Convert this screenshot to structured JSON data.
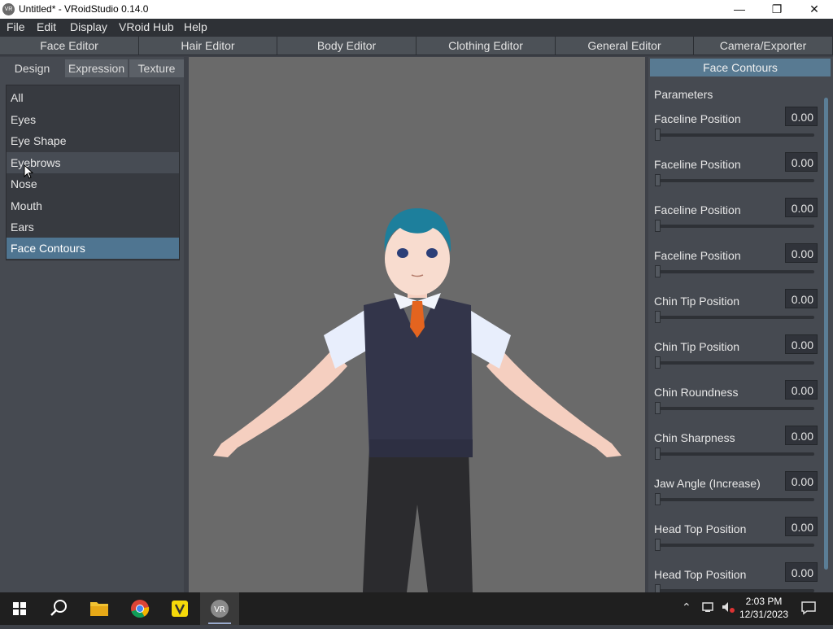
{
  "window": {
    "title": "Untitled* - VRoidStudio 0.14.0",
    "app_icon": "VR",
    "controls": {
      "minimize": "—",
      "maximize": "❐",
      "close": "✕"
    }
  },
  "menu": {
    "items": [
      "File",
      "Edit",
      "Display",
      "VRoid Hub",
      "Help"
    ]
  },
  "editor_tabs": [
    "Face Editor",
    "Hair Editor",
    "Body Editor",
    "Clothing Editor",
    "General Editor",
    "Camera/Exporter"
  ],
  "left_panel": {
    "subtabs": [
      "Design",
      "Expression",
      "Texture"
    ],
    "active_subtab": "Design",
    "categories": [
      "All",
      "Eyes",
      "Eye Shape",
      "Eyebrows",
      "Nose",
      "Mouth",
      "Ears",
      "Face Contours"
    ],
    "selected_category": "Face Contours",
    "hovered_category": "Eyebrows"
  },
  "right_panel": {
    "header": "Face Contours",
    "section_title": "Parameters",
    "params": [
      {
        "label": "Faceline Position",
        "value": "0.00"
      },
      {
        "label": "Faceline Position",
        "value": "0.00"
      },
      {
        "label": "Faceline Position",
        "value": "0.00"
      },
      {
        "label": "Faceline Position",
        "value": "0.00"
      },
      {
        "label": "Chin Tip Position",
        "value": "0.00"
      },
      {
        "label": "Chin Tip Position",
        "value": "0.00"
      },
      {
        "label": "Chin Roundness",
        "value": "0.00"
      },
      {
        "label": "Chin Sharpness",
        "value": "0.00"
      },
      {
        "label": "Jaw Angle (Increase)",
        "value": "0.00"
      },
      {
        "label": "Head Top Position",
        "value": "0.00"
      },
      {
        "label": "Head Top Position",
        "value": "0.00"
      }
    ]
  },
  "taskbar": {
    "apps": [
      "windows-start-icon",
      "search-icon",
      "file-explorer-icon",
      "chrome-icon",
      "vroid-hub-icon",
      "vroid-studio-icon"
    ],
    "time": "2:03 PM",
    "date": "12/31/2023"
  },
  "colors": {
    "accent": "#587a92",
    "selected": "#4f7591",
    "viewport_bg": "#6a6a6a",
    "panel_bg": "#464a51"
  }
}
